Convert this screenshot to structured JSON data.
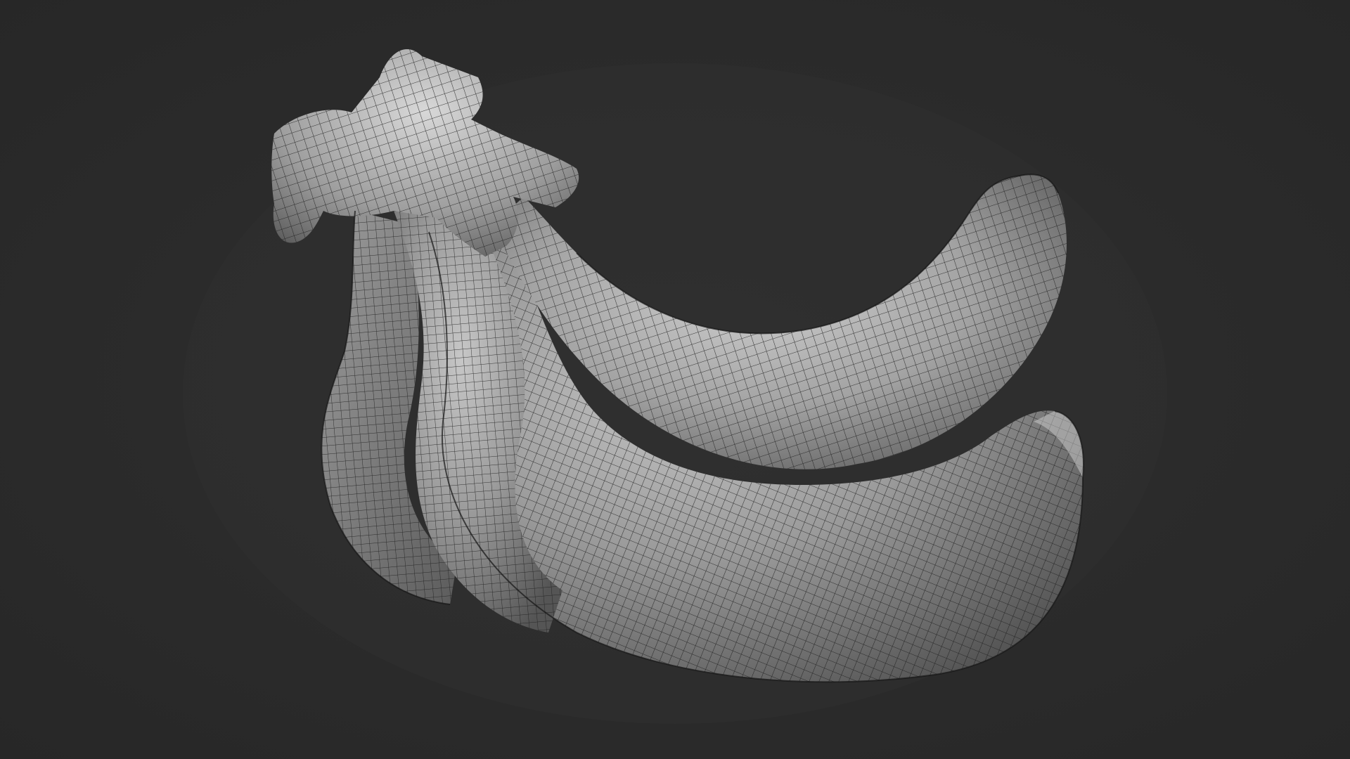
{
  "viewport": {
    "background_color": "#2b2b2b",
    "shading": "matcap-gray",
    "overlay": "wireframe"
  },
  "model": {
    "subject": "banana-bunch",
    "fruit_count": 3,
    "surface_color": "#a9a9a9",
    "wire_color": "#1e1e1e"
  }
}
